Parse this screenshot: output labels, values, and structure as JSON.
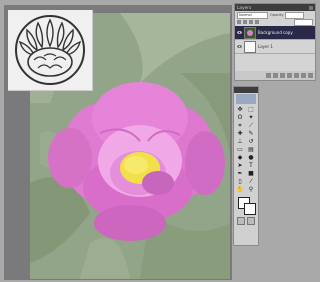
{
  "document": {
    "stencil_color": "#333333"
  },
  "layers_panel": {
    "tab_label": "Layers",
    "blend_mode": "Normal",
    "opacity_label": "Opacity",
    "opacity_value": "",
    "layers": [
      {
        "name": "Background copy",
        "selected": true
      },
      {
        "name": "Layer 1",
        "selected": false
      }
    ]
  },
  "toolbox": {
    "tools": [
      {
        "icon": "move-icon",
        "glyph": "✥"
      },
      {
        "icon": "marquee-icon",
        "glyph": "⬚"
      },
      {
        "icon": "lasso-icon",
        "glyph": "ʘ"
      },
      {
        "icon": "magic-wand-icon",
        "glyph": "✦"
      },
      {
        "icon": "crop-icon",
        "glyph": "⌗"
      },
      {
        "icon": "slice-icon",
        "glyph": "⟋"
      },
      {
        "icon": "healing-icon",
        "glyph": "✚"
      },
      {
        "icon": "brush-icon",
        "glyph": "✎"
      },
      {
        "icon": "stamp-icon",
        "glyph": "⊥"
      },
      {
        "icon": "history-brush-icon",
        "glyph": "↺"
      },
      {
        "icon": "eraser-icon",
        "glyph": "▭"
      },
      {
        "icon": "gradient-icon",
        "glyph": "▤"
      },
      {
        "icon": "blur-icon",
        "glyph": "◆"
      },
      {
        "icon": "dodge-icon",
        "glyph": "●"
      },
      {
        "icon": "path-select-icon",
        "glyph": "➤"
      },
      {
        "icon": "type-icon",
        "glyph": "T"
      },
      {
        "icon": "pen-icon",
        "glyph": "✒"
      },
      {
        "icon": "shape-icon",
        "glyph": "■"
      },
      {
        "icon": "notes-icon",
        "glyph": "▯"
      },
      {
        "icon": "eyedropper-icon",
        "glyph": "⁄"
      },
      {
        "icon": "hand-icon",
        "glyph": "✋"
      },
      {
        "icon": "zoom-icon",
        "glyph": "⚲"
      }
    ],
    "foreground_color": "#ffffff",
    "background_color": "#ffffff"
  }
}
